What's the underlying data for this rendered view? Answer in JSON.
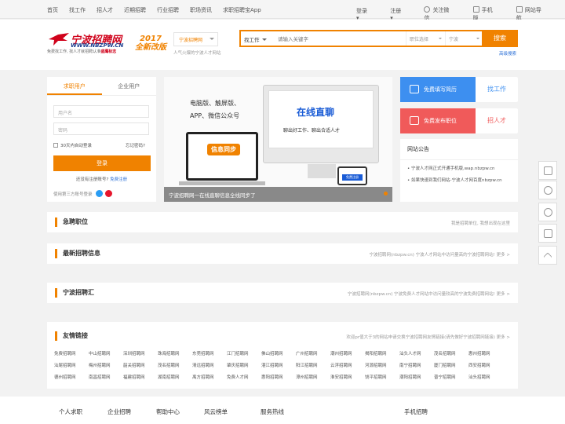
{
  "topbar": {
    "nav": [
      "首页",
      "找工作",
      "招人才",
      "近期招聘",
      "行业招聘",
      "职场资讯",
      "求职招聘宝App"
    ],
    "login": "登录",
    "register": "注册",
    "wechat": "关注微信",
    "mobile": "手机版",
    "sitenav": "网站导航"
  },
  "header": {
    "brand": "宁波招聘网",
    "url": "WWW.NBZPW.CN",
    "slogan_pre": "免费找工作, 找人才就招聘认准",
    "slogan_bold": "盛鹰标志",
    "year": "2017",
    "edition": "全新改版",
    "site": "宁波招聘网",
    "site_tip": "人气火爆的宁波人才网站",
    "search_cat": "找工作",
    "search_placeholder": "请输入关键字",
    "pos_select": "职位选择",
    "region_select": "宁波",
    "search_btn": "搜索",
    "advanced": "高级搜索"
  },
  "login": {
    "tab_person": "求职用户",
    "tab_company": "企业用户",
    "username": "用户名",
    "password": "密码",
    "auto": "30天内自动登录",
    "forgot": "忘记密码?",
    "submit": "登录",
    "no_account": "还没有注册账号?",
    "reg_free": "免费注册",
    "third": "使用第三方账号登录"
  },
  "banner": {
    "features": [
      "电脑版、触屏版、",
      "APP、微信公众号"
    ],
    "live": "在线直聊",
    "live_sub": "聊出好工作、聊出合适人才",
    "sync": "信息同步",
    "phone_reg": "免费注册",
    "caption": "宁波招聘网一在线直聊信息全线同步了"
  },
  "cards": [
    {
      "left": "免费填写简历",
      "right": "找工作",
      "color": "#3d8ff0"
    },
    {
      "left": "免费发布职位",
      "right": "招人才",
      "color": "#f05a5a"
    }
  ],
  "notice": {
    "title": "网站公告",
    "items": [
      "宁波人才网正式开通手机版,wap.nbzpw.cn",
      "如果快速到我们网站-宁波人才网百度nbzpw.cn"
    ]
  },
  "sections": [
    {
      "title": "急聘职位",
      "desc": "我是招聘单位, 我想出现在这里"
    },
    {
      "title": "最新招聘信息",
      "desc": "宁波招聘网(nbzpw.cn) 宁波人才网站中访问量高的宁波招聘网站!  更多 >"
    },
    {
      "title": "宁波招聘汇",
      "desc": "宁波招聘网(nbzpw.cn) 宁波免费人才网站中访问量较高的宁波免费招聘网站!  更多 >"
    }
  ],
  "links": {
    "title": "友情链接",
    "desc": "欢迎pr值大于3的网站申请交换宁波招聘网友情链接(请先做好宁波招聘网链接)  更多 >",
    "items": [
      "免费招聘网",
      "中山招聘网",
      "深圳招聘网",
      "珠海招聘网",
      "东莞招聘网",
      "江门招聘网",
      "佛山招聘网",
      "广州招聘网",
      "潮州招聘网",
      "揭阳招聘网",
      "汕头人才网",
      "茂名招聘网",
      "惠州招聘网",
      "汕尾招聘网",
      "梅州招聘网",
      "韶关招聘网",
      "茂名招聘网",
      "清远招聘网",
      "肇庆招聘网",
      "湛江招聘网",
      "阳江招聘网",
      "云浮招聘网",
      "河源招聘网",
      "南宁招聘网",
      "厦门招聘网",
      "西安招聘网",
      "德州招聘网",
      "南昌招聘网",
      "福建招聘网",
      "湖南招聘网",
      "禹方招聘网",
      "免费人才网",
      "惠阳招聘网",
      "漳州招聘网",
      "淮安招聘网",
      "饶平招聘网",
      "潮阳招聘网",
      "普宁招聘网",
      "汕头招聘网"
    ]
  },
  "footer": [
    "个人求职",
    "企业招聘",
    "帮助中心",
    "风云榜单",
    "服务热线",
    "手机招聘"
  ]
}
